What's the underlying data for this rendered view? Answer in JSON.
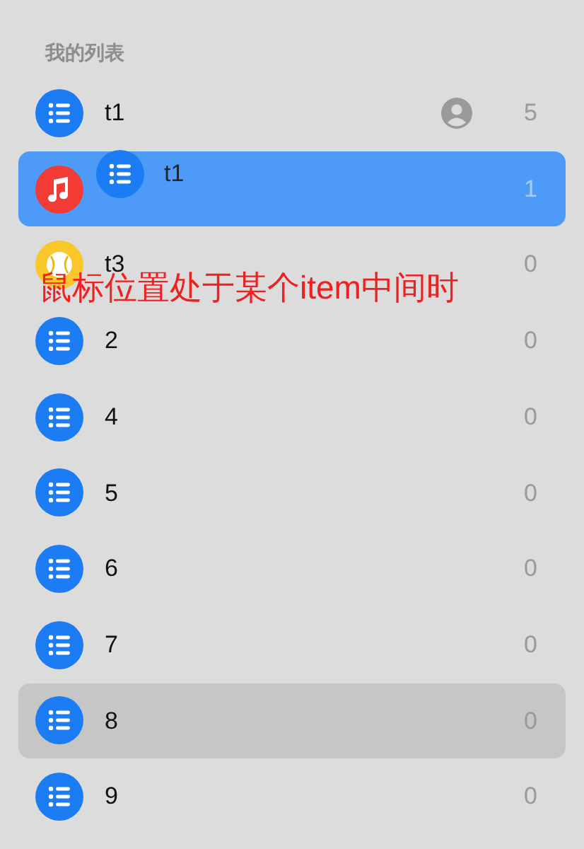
{
  "section_title": "我的列表",
  "lists": [
    {
      "name": "t1",
      "kind": "list",
      "color": "#1b7cf4",
      "shared": true,
      "count": "5",
      "drop_target": false,
      "selected": false
    },
    {
      "kind": "music",
      "color": "#f23b35",
      "shared": false,
      "count": "1",
      "drop_target": true,
      "selected": false
    },
    {
      "name": "t3",
      "kind": "ball",
      "color": "#f9c72a",
      "shared": false,
      "count": "0",
      "drop_target": false,
      "selected": false
    },
    {
      "name": "2",
      "kind": "list",
      "color": "#1b7cf4",
      "shared": false,
      "count": "0",
      "drop_target": false,
      "selected": false
    },
    {
      "name": "4",
      "kind": "list",
      "color": "#1b7cf4",
      "shared": false,
      "count": "0",
      "drop_target": false,
      "selected": false
    },
    {
      "name": "5",
      "kind": "list",
      "color": "#1b7cf4",
      "shared": false,
      "count": "0",
      "drop_target": false,
      "selected": false
    },
    {
      "name": "6",
      "kind": "list",
      "color": "#1b7cf4",
      "shared": false,
      "count": "0",
      "drop_target": false,
      "selected": false
    },
    {
      "name": "7",
      "kind": "list",
      "color": "#1b7cf4",
      "shared": false,
      "count": "0",
      "drop_target": false,
      "selected": false
    },
    {
      "name": "8",
      "kind": "list",
      "color": "#1b7cf4",
      "shared": false,
      "count": "0",
      "drop_target": false,
      "selected": true
    },
    {
      "name": "9",
      "kind": "list",
      "color": "#1b7cf4",
      "shared": false,
      "count": "0",
      "drop_target": false,
      "selected": false
    }
  ],
  "drag_preview": {
    "name": "t1",
    "kind": "list",
    "color": "#1b7cf4"
  },
  "annotation": "鼠标位置处于某个item中间时"
}
